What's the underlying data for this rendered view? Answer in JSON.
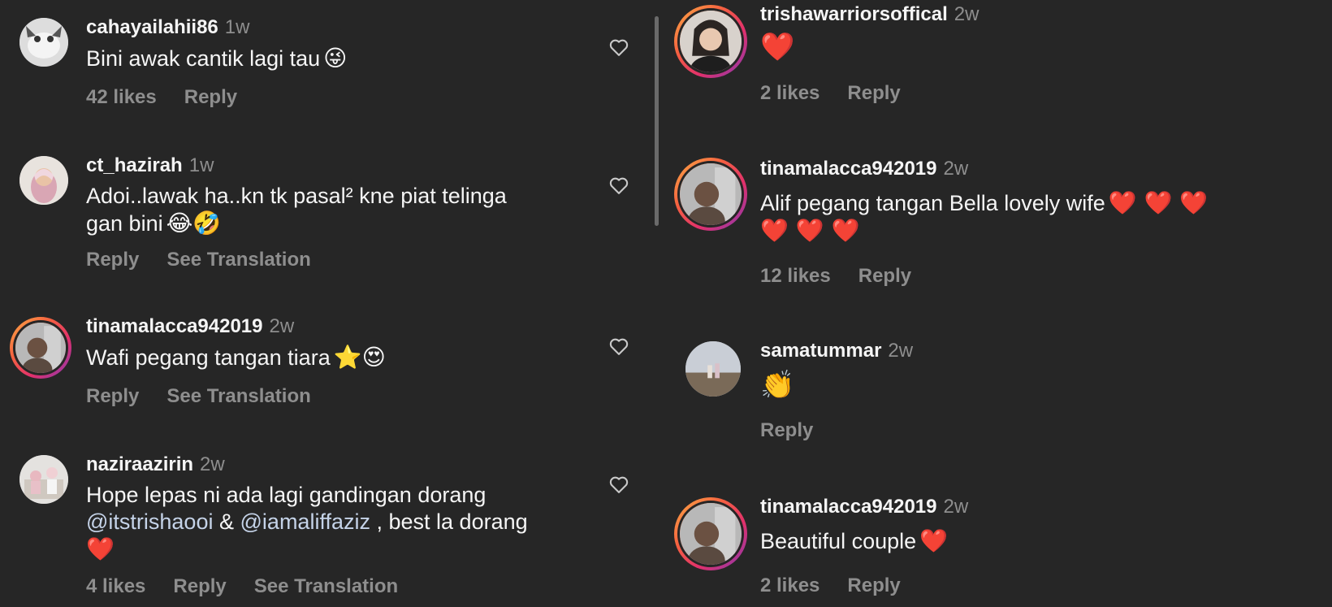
{
  "left_comments": [
    {
      "username": "cahayailahii86",
      "time": "1w",
      "text": "Bini awak cantik lagi tau",
      "emojis": "😜",
      "likes": "42 likes",
      "reply": "Reply"
    },
    {
      "username": "ct_hazirah",
      "time": "1w",
      "text_line1": "Adoi..lawak ha..kn tk pasal² kne piat telinga",
      "text_line2": "gan bini",
      "emojis": "😂🤣",
      "reply": "Reply",
      "see_translation": "See Translation"
    },
    {
      "username": "tinamalacca942019",
      "time": "2w",
      "text": "Wafi pegang tangan tiara",
      "emojis": "⭐😍",
      "reply": "Reply",
      "see_translation": "See Translation"
    },
    {
      "username": "naziraazirin",
      "time": "2w",
      "text_line1": "Hope lepas ni ada lagi gandingan dorang",
      "mention1": "@itstrishaooi",
      "amp": "&",
      "mention2": "@iamaliffaziz",
      "text_after": ", best la dorang",
      "emojis": "❤️",
      "likes": "4 likes",
      "reply": "Reply",
      "see_translation": "See Translation"
    }
  ],
  "right_comments": [
    {
      "username": "trishawarriorsoffical",
      "time": "2w",
      "emojis": "❤️",
      "likes": "2 likes",
      "reply": "Reply"
    },
    {
      "username": "tinamalacca942019",
      "time": "2w",
      "text": "Alif pegang tangan Bella lovely wife",
      "emojis_line1": "❤️ ❤️ ❤️",
      "emojis_line2": "❤️ ❤️ ❤️",
      "likes": "12 likes",
      "reply": "Reply"
    },
    {
      "username": "samatummar",
      "time": "2w",
      "emojis": "👏",
      "reply": "Reply"
    },
    {
      "username": "tinamalacca942019",
      "time": "2w",
      "text": "Beautiful couple",
      "emojis": "❤️",
      "likes": "2 likes",
      "reply": "Reply"
    }
  ],
  "icons": {
    "like": "heart-outline-icon"
  },
  "colors": {
    "background": "#262626",
    "secondary_text": "#8e8e8e",
    "heart": "#e0241b",
    "mention": "#c5d3e8"
  }
}
